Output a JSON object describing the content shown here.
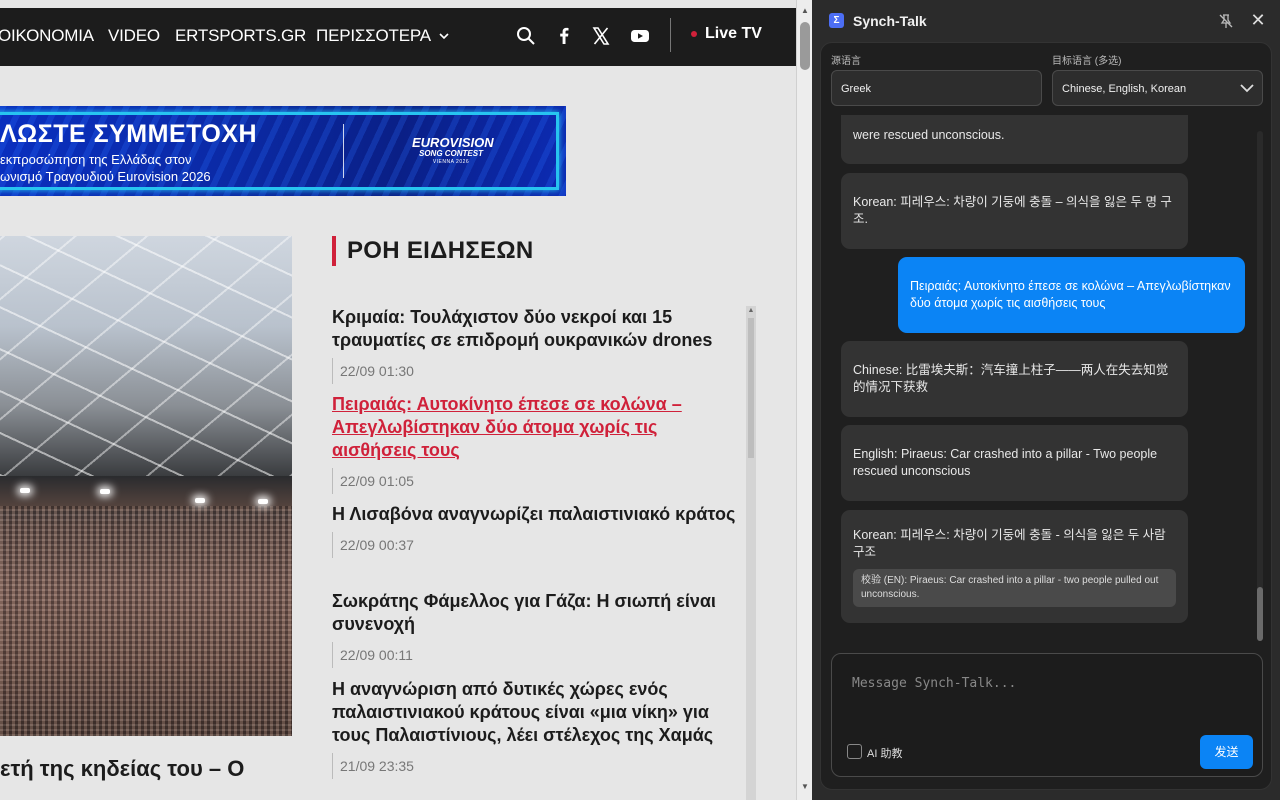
{
  "site": {
    "nav": {
      "items": [
        "ΟΙΚΟΝΟΜΙΑ",
        "VIDEO",
        "ERTSPORTS.GR",
        "ΠΕΡΙΣΣΟΤΕΡΑ"
      ],
      "live_label": "Live TV"
    },
    "banner": {
      "headline": "ΛΩΣΤΕ ΣΥΜΜΕΤΟΧΗ",
      "line1": "εκπροσώπηση της Ελλάδας στον",
      "line2": "ωνισμό Τραγουδιού Eurovision 2026",
      "logo_line1": "EUROVISION",
      "logo_line2": "SONG CONTEST",
      "logo_line3": "VIENNA 2026"
    },
    "caption": "ετή της κηδείας του – Ο",
    "feed": {
      "title": "ΡΟΗ ΕΙΔΗΣΕΩΝ",
      "items": [
        {
          "title": "Κριμαία: Τουλάχιστον δύο νεκροί και 15 τραυματίες σε επιδρομή ουκρανικών drones",
          "time": "22/09 01:30"
        },
        {
          "title": "Πειραιάς: Αυτοκίνητο έπεσε σε κολώνα – Απεγλωβίστηκαν δύο άτομα χωρίς τις αισθήσεις τους",
          "time": "22/09 01:05"
        },
        {
          "title": "Η Λισαβόνα αναγνωρίζει παλαιστινιακό κράτος",
          "time": "22/09 00:37"
        },
        {
          "title": "Σωκράτης Φάμελλος για Γάζα: Η σιωπή είναι συνενοχή",
          "time": "22/09 00:11"
        },
        {
          "title": "Η αναγνώριση από δυτικές χώρες ενός παλαιστινιακού κράτους είναι «μια νίκη» για τους Παλαιστίνιους, λέει στέλεχος της Χαμάς",
          "time": "21/09 23:35"
        }
      ]
    }
  },
  "panel": {
    "title": "Synch-Talk",
    "source_label": "源语言",
    "source_value": "Greek",
    "target_label": "目标语言 (多选)",
    "target_value": "Chinese, English, Korean",
    "messages": [
      {
        "text": "were rescued unconscious."
      },
      {
        "text": "Korean: 피레우스: 차량이 기둥에 충돌 – 의식을 잃은 두 명 구조."
      },
      {
        "text": "Πειραιάς: Αυτοκίνητο έπεσε σε κολώνα – Απεγλωβίστηκαν δύο άτομα χωρίς τις αισθήσεις τους"
      },
      {
        "text": "Chinese: 比雷埃夫斯：汽车撞上柱子——两人在失去知觉的情况下获救"
      },
      {
        "text": "English: Piraeus: Car crashed into a pillar - Two people rescued unconscious"
      },
      {
        "text": "Korean: 피레우스: 차량이 기둥에 충돌 - 의식을 잃은 두 사람 구조",
        "verify": "校验 (EN): Piraeus: Car crashed into a pillar - two people pulled out unconscious."
      }
    ],
    "input_placeholder": "Message Synch-Talk...",
    "ai_label": "AI 助教",
    "send_label": "发送"
  }
}
